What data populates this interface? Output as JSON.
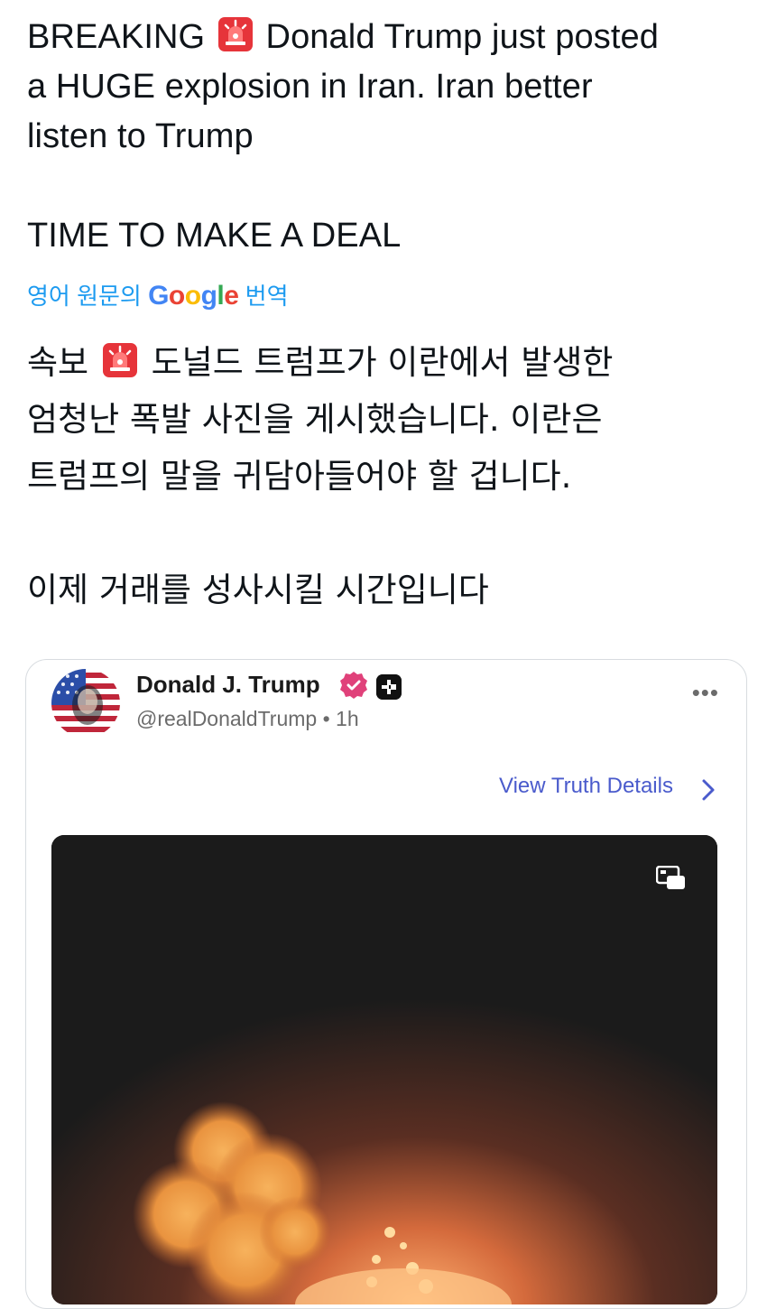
{
  "tweet": {
    "lines": [
      "BREAKING",
      "Donald Trump just posted",
      "a HUGE explosion in Iran. Iran better",
      "listen to Trump",
      "TIME TO MAKE A DEAL"
    ]
  },
  "translate_bar": {
    "prefix": "영어 원문의",
    "google_letters": [
      "G",
      "o",
      "o",
      "g",
      "l",
      "e"
    ],
    "suffix": "번역"
  },
  "translated": {
    "lines": [
      "속보",
      "도널드 트럼프가 이란에서 발생한",
      "엄청난 폭발 사진을 게시했습니다. 이란은",
      "트럼프의 말을 귀담아들어야 할 겁니다.",
      "이제 거래를 성사시킬 시간입니다"
    ]
  },
  "embedded_post": {
    "author_name": "Donald J. Trump",
    "handle": "@realDonaldTrump",
    "separator": "•",
    "time": "1h",
    "more_label": "•••",
    "view_details_label": "View Truth Details"
  },
  "colors": {
    "link_blue": "#1d9bf0",
    "verified_pink": "#e0417a",
    "view_details": "#4a5bcc"
  },
  "icons": {
    "siren": "rotating-light",
    "verified": "verified-badge",
    "plus": "plus-badge",
    "chevron": "chevron-right",
    "media": "picture-in-picture"
  }
}
